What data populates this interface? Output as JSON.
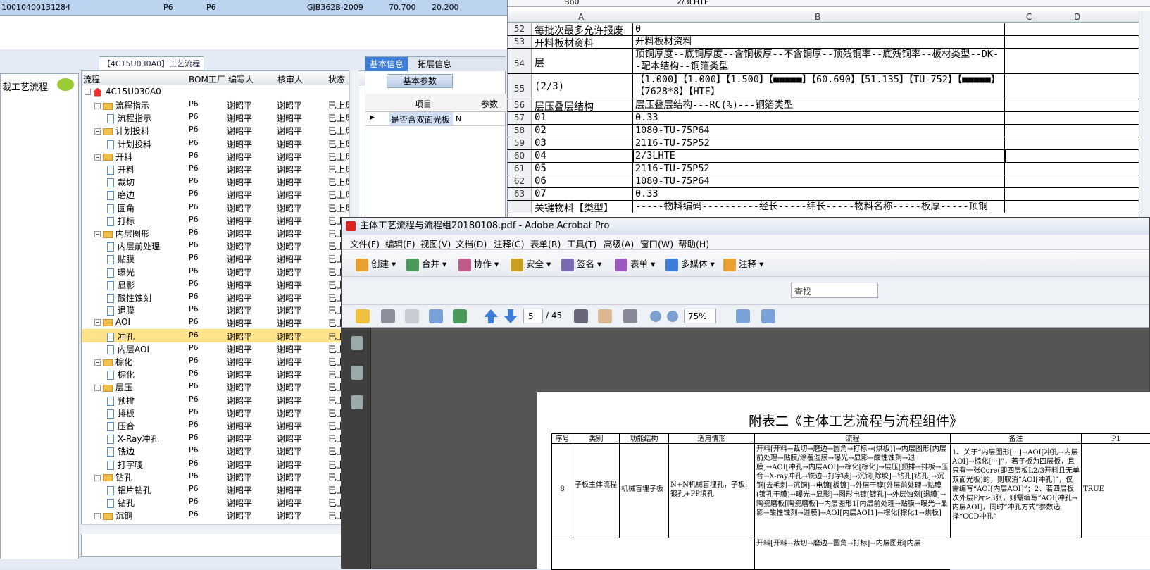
{
  "top_record": {
    "code": "10010400131284",
    "factory1": "P6",
    "factory2": "P6",
    "standard": "GJB362B-2009",
    "v1": "70.700",
    "v2": "20.200"
  },
  "nav": {
    "item": "裁工艺流程"
  },
  "flow_tab": "【4C15U030A0】工艺流程",
  "tree": {
    "columns": [
      "流程",
      "BOM工厂",
      "编写人",
      "核审人",
      "状态"
    ],
    "root": "4C15U030A0",
    "rows": [
      {
        "name": "流程指示",
        "type": "folder",
        "level": 1,
        "bom": "P6",
        "writer": "谢昭平",
        "reviewer": "谢昭平",
        "status": "已上风"
      },
      {
        "name": "流程指示",
        "type": "doc",
        "level": 2,
        "bom": "P6",
        "writer": "谢昭平",
        "reviewer": "谢昭平",
        "status": "已上风"
      },
      {
        "name": "计划投料",
        "type": "folder",
        "level": 1,
        "bom": "P6",
        "writer": "谢昭平",
        "reviewer": "谢昭平",
        "status": "已上风"
      },
      {
        "name": "计划投料",
        "type": "doc",
        "level": 2,
        "bom": "P6",
        "writer": "谢昭平",
        "reviewer": "谢昭平",
        "status": "已上风"
      },
      {
        "name": "开料",
        "type": "folder",
        "level": 1,
        "bom": "P6",
        "writer": "谢昭平",
        "reviewer": "谢昭平",
        "status": "已上风"
      },
      {
        "name": "开料",
        "type": "doc",
        "level": 2,
        "bom": "P6",
        "writer": "谢昭平",
        "reviewer": "谢昭平",
        "status": "已上风"
      },
      {
        "name": "裁切",
        "type": "doc",
        "level": 2,
        "bom": "P6",
        "writer": "谢昭平",
        "reviewer": "谢昭平",
        "status": "已上风"
      },
      {
        "name": "磨边",
        "type": "doc",
        "level": 2,
        "bom": "P6",
        "writer": "谢昭平",
        "reviewer": "谢昭平",
        "status": "已上风"
      },
      {
        "name": "圆角",
        "type": "doc",
        "level": 2,
        "bom": "P6",
        "writer": "谢昭平",
        "reviewer": "谢昭平",
        "status": "已上风"
      },
      {
        "name": "打标",
        "type": "doc",
        "level": 2,
        "bom": "P6",
        "writer": "谢昭平",
        "reviewer": "谢昭平",
        "status": "已上风"
      },
      {
        "name": "内层图形",
        "type": "folder",
        "level": 1,
        "bom": "P6",
        "writer": "谢昭平",
        "reviewer": "谢昭平",
        "status": "已上风"
      },
      {
        "name": "内层前处理",
        "type": "doc",
        "level": 2,
        "bom": "P6",
        "writer": "谢昭平",
        "reviewer": "谢昭平",
        "status": "已上风"
      },
      {
        "name": "贴膜",
        "type": "doc",
        "level": 2,
        "bom": "P6",
        "writer": "谢昭平",
        "reviewer": "谢昭平",
        "status": "已上风"
      },
      {
        "name": "曝光",
        "type": "doc",
        "level": 2,
        "bom": "P6",
        "writer": "谢昭平",
        "reviewer": "谢昭平",
        "status": "已上风"
      },
      {
        "name": "显影",
        "type": "doc",
        "level": 2,
        "bom": "P6",
        "writer": "谢昭平",
        "reviewer": "谢昭平",
        "status": "已上风"
      },
      {
        "name": "酸性蚀刻",
        "type": "doc",
        "level": 2,
        "bom": "P6",
        "writer": "谢昭平",
        "reviewer": "谢昭平",
        "status": "已上风"
      },
      {
        "name": "退膜",
        "type": "doc",
        "level": 2,
        "bom": "P6",
        "writer": "谢昭平",
        "reviewer": "谢昭平",
        "status": "已上风"
      },
      {
        "name": "AOI",
        "type": "folder",
        "level": 1,
        "bom": "P6",
        "writer": "谢昭平",
        "reviewer": "谢昭平",
        "status": "已上风"
      },
      {
        "name": "冲孔",
        "type": "doc",
        "level": 2,
        "bom": "P6",
        "writer": "谢昭平",
        "reviewer": "谢昭平",
        "status": "已上风",
        "selected": true
      },
      {
        "name": "内层AOI",
        "type": "doc",
        "level": 2,
        "bom": "P6",
        "writer": "谢昭平",
        "reviewer": "谢昭平",
        "status": "已上风"
      },
      {
        "name": "棕化",
        "type": "folder",
        "level": 1,
        "bom": "P6",
        "writer": "谢昭平",
        "reviewer": "谢昭平",
        "status": "已上风"
      },
      {
        "name": "棕化",
        "type": "doc",
        "level": 2,
        "bom": "P6",
        "writer": "谢昭平",
        "reviewer": "谢昭平",
        "status": "已上风"
      },
      {
        "name": "层压",
        "type": "folder",
        "level": 1,
        "bom": "P6",
        "writer": "谢昭平",
        "reviewer": "谢昭平",
        "status": "已上风"
      },
      {
        "name": "预排",
        "type": "doc",
        "level": 2,
        "bom": "P6",
        "writer": "谢昭平",
        "reviewer": "谢昭平",
        "status": "已上风"
      },
      {
        "name": "排板",
        "type": "doc",
        "level": 2,
        "bom": "P6",
        "writer": "谢昭平",
        "reviewer": "谢昭平",
        "status": "已上风"
      },
      {
        "name": "压合",
        "type": "doc",
        "level": 2,
        "bom": "P6",
        "writer": "谢昭平",
        "reviewer": "谢昭平",
        "status": "已上风"
      },
      {
        "name": "X-Ray冲孔",
        "type": "doc",
        "level": 2,
        "bom": "P6",
        "writer": "谢昭平",
        "reviewer": "谢昭平",
        "status": "已上风"
      },
      {
        "name": "铣边",
        "type": "doc",
        "level": 2,
        "bom": "P6",
        "writer": "谢昭平",
        "reviewer": "谢昭平",
        "status": "已上风"
      },
      {
        "name": "打字唛",
        "type": "doc",
        "level": 2,
        "bom": "P6",
        "writer": "谢昭平",
        "reviewer": "谢昭平",
        "status": "已上风"
      },
      {
        "name": "钻孔",
        "type": "folder",
        "level": 1,
        "bom": "P6",
        "writer": "谢昭平",
        "reviewer": "谢昭平",
        "status": "已上风"
      },
      {
        "name": "铝片钻孔",
        "type": "doc",
        "level": 2,
        "bom": "P6",
        "writer": "谢昭平",
        "reviewer": "谢昭平",
        "status": "已上风"
      },
      {
        "name": "钻孔",
        "type": "doc",
        "level": 2,
        "bom": "P6",
        "writer": "谢昭平",
        "reviewer": "谢昭平",
        "status": "已上风"
      },
      {
        "name": "沉铜",
        "type": "folder",
        "level": 1,
        "bom": "P6",
        "writer": "谢昭平",
        "reviewer": "谢昭平",
        "status": "已上风"
      }
    ]
  },
  "info": {
    "tabs": [
      "基本信息",
      "拓展信息"
    ],
    "subtab": "基本参数",
    "columns": [
      "项目",
      "参数"
    ],
    "row": {
      "item": "是否含双面光板",
      "value": "N"
    }
  },
  "excel": {
    "name_box": "B60",
    "formula": "2/3LHTE",
    "columns": [
      "A",
      "B",
      "C",
      "D"
    ],
    "rows": [
      {
        "n": "52",
        "a": "每批次最多允许报废",
        "b": "0"
      },
      {
        "n": "53",
        "a": "开料板材资料",
        "b": "开料板材资料"
      },
      {
        "n": "54",
        "a": "层",
        "b": "顶铜厚度--底铜厚度--含铜板厚--不含铜厚--顶残铜率--底残铜率--板材类型--DK--配本结构--铜箔类型"
      },
      {
        "n": "55",
        "a": "(2/3)",
        "b": "【1.000】【1.000】【1.500】【■■■■■】【60.690】【51.135】【TU-752】【■■■■■】【7628*8】【HTE】"
      },
      {
        "n": "56",
        "a": "层压叠层结构",
        "b": "层压叠层结构---RC(%)---铜箔类型"
      },
      {
        "n": "57",
        "a": "01",
        "b": "0.33"
      },
      {
        "n": "58",
        "a": "02",
        "b": "1080-TU-75P64"
      },
      {
        "n": "59",
        "a": "03",
        "b": "2116-TU-75P52"
      },
      {
        "n": "60",
        "a": "04",
        "b": "2/3LHTE"
      },
      {
        "n": "61",
        "a": "05",
        "b": "2116-TU-75P52"
      },
      {
        "n": "62",
        "a": "06",
        "b": "1080-TU-75P64"
      },
      {
        "n": "63",
        "a": "07",
        "b": "0.33"
      },
      {
        "n": "",
        "a": "关键物料【类型】",
        "b": "-----物料编码----------经长-----纬长-----物料名称-----板厚-----顶铜"
      }
    ]
  },
  "acrobat": {
    "title": "主体工艺流程与流程组20180108.pdf - Adobe Acrobat Pro",
    "menu": [
      "文件(F)",
      "编辑(E)",
      "视图(V)",
      "文档(D)",
      "注释(C)",
      "表单(R)",
      "工具(T)",
      "高级(A)",
      "窗口(W)",
      "帮助(H)"
    ],
    "toolbar": [
      "创建",
      "合并",
      "协作",
      "安全",
      "签名",
      "表单",
      "多媒体",
      "注释"
    ],
    "find_placeholder": "查找",
    "page": "5",
    "page_total": "/ 45",
    "zoom": "75%",
    "doc_title": "附表二《主体工艺流程与流程组件》",
    "table_headers": [
      "序号",
      "类别",
      "功能结构",
      "适用情形",
      "流程",
      "备注",
      "P1"
    ],
    "row": {
      "no": "8",
      "category": "子板主体流程",
      "function": "机械盲埋子板",
      "situation": "N+N机械盲埋孔，子板:镀孔+PP填孔",
      "flow": "开料[开料→裁切→磨边→圆角→打标→(烘板)]→内层图形[内层前处理→贴膜/涂覆湿膜→曝光→显影→酸性蚀刻→退膜]→AOI[冲孔→内层AOI]→棕化[棕化]→层压[预排→排板→压合→X-ray冲孔→铣边→打字唛]→沉铜[除胶]→钻孔[钻孔]→沉铜[去毛刺→沉铜]→电镀[板镀]→外层干膜[外层前处理→贴膜(镀孔干膜)→曝光→显影]→图形电镀[镀孔]→外层蚀刻[退膜]→陶瓷磨板[陶瓷磨板]→内层图形1[内层前处理→贴膜→曝光→显影→酸性蚀刻→退膜]→AOI[内层AOI1]→棕化[棕化1→烘板]",
      "remark": "1、关于“内层图形[···]→AOI[冲孔→内层AOI]→棕化[···]”，若子板为四层板，且只有一张Core(即四层板L2/3开料且无单双面光板)的，则取消“AOI[冲孔]”，仅需编写“AOI[内层AOI]”；2、若四层板次外层P片≥3张，则需编写“AOI[冲孔→内层AOI]，同时“冲孔方式”参数选择“CCD冲孔”",
      "p1": "TRUE"
    },
    "next_row_flow": "开料[开料→裁切→磨边→圆角→打标]→内层图形[内层"
  }
}
